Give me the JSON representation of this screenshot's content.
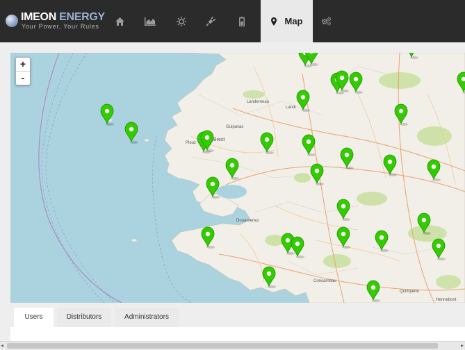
{
  "header": {
    "brand": "IMEON",
    "brand_accent": "ENERGY",
    "tagline": "Your Power, Your Rules",
    "nav": [
      {
        "icon": "home-icon"
      },
      {
        "icon": "area-chart-icon"
      },
      {
        "icon": "sun-icon"
      },
      {
        "icon": "plug-icon"
      },
      {
        "icon": "battery-icon"
      },
      {
        "icon": "map-marker-icon",
        "label": "Map",
        "active": true
      },
      {
        "icon": "gears-icon"
      }
    ]
  },
  "map": {
    "zoom_in": "+",
    "zoom_out": "-",
    "place_labels": [
      "Landerneau",
      "Landi",
      "Guipavas",
      "Brest",
      "Plouz",
      "Douarnenez",
      "Concarneau",
      "Quimperlé",
      "Hennebont"
    ],
    "marker_count": 31,
    "marker_color": "#33cc00"
  },
  "tabs": [
    {
      "label": "Users",
      "active": true
    },
    {
      "label": "Distributors",
      "active": false
    },
    {
      "label": "Administrators",
      "active": false
    }
  ],
  "scrollbar": {
    "left_arrow": "◂",
    "right_arrow": "▸"
  }
}
